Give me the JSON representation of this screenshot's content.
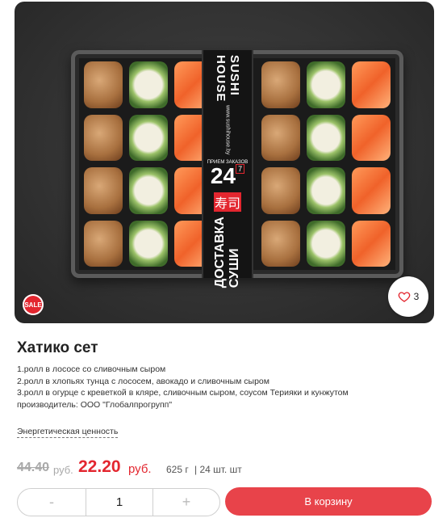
{
  "product": {
    "title": "Хатико сет",
    "description": [
      "1.ролл в лососе со сливочным сыром",
      "2.ролл в хлопьях тунца с лососем, авокадо и сливочным сыром",
      "3.ролл в огурце с креветкой в кляре, сливочным сыром, соусом Терияки и кунжутом",
      "производитель: ООО \"Глобалпрогрупп\""
    ],
    "energy_link": "Энергетическая ценность",
    "old_price": "44.40",
    "old_currency": "руб.",
    "new_price": "22.20",
    "new_currency": "руб.",
    "weight": "625 г",
    "pieces": "| 24 шт. шт"
  },
  "image": {
    "sale_badge": "SALE",
    "favorites_count": "3",
    "band_brand": "SUSHI HOUSE",
    "band_url": "www.sushihouse.by",
    "band_hours": "ПРИЕМ ЗАКАЗОВ",
    "band_num": "24",
    "band_sup": "7",
    "band_kanji": "寿司",
    "band_word": "ДОСТАВКА СУШИ",
    "heart_icon": "heart-outline-icon"
  },
  "controls": {
    "minus": "-",
    "quantity": "1",
    "plus": "+",
    "add_to_cart": "В корзину"
  },
  "colors": {
    "accent": "#e3262f",
    "button": "#e8434a"
  }
}
